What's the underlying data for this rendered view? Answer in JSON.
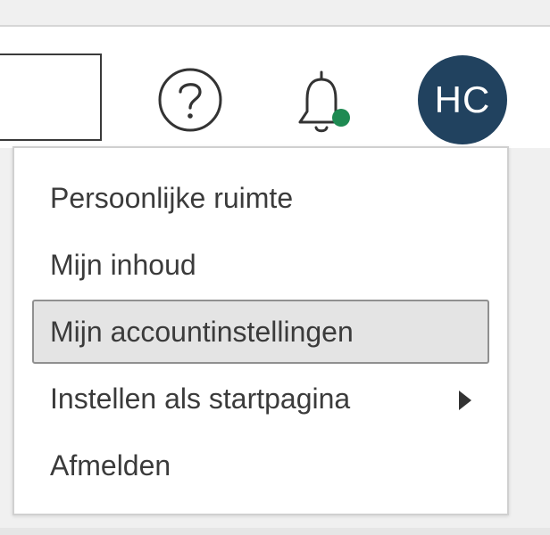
{
  "header": {
    "search": {
      "placeholder": ""
    },
    "help_icon": "question-circle-icon",
    "bell_icon": "bell-icon",
    "notification_dot_color": "#1e8a52",
    "user": {
      "initials": "HC",
      "avatar_color": "#21425f"
    }
  },
  "user_menu": {
    "items": [
      {
        "label": "Persoonlijke ruimte"
      },
      {
        "label": "Mijn inhoud"
      },
      {
        "label": "Mijn accountinstellingen",
        "highlighted": true
      },
      {
        "label": "Instellen als startpagina",
        "has_submenu": true
      },
      {
        "label": "Afmelden"
      }
    ]
  }
}
